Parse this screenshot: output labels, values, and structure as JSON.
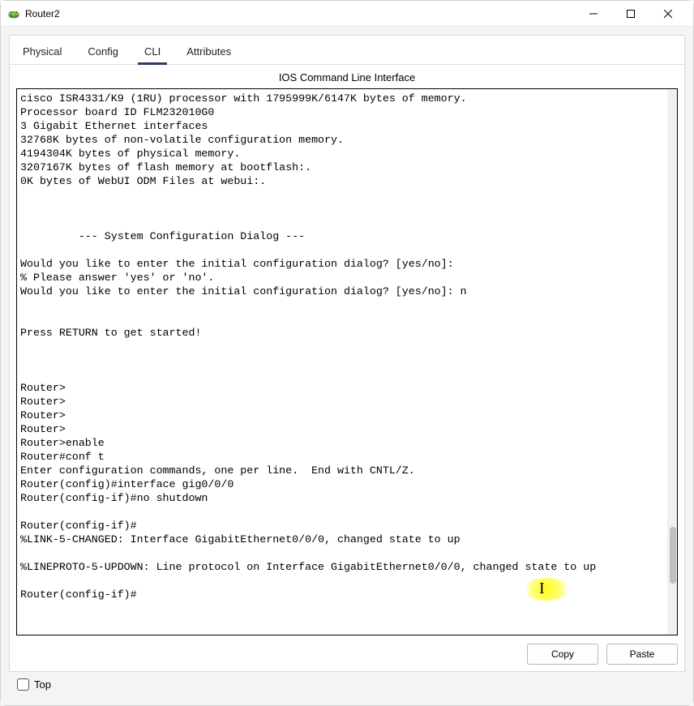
{
  "window": {
    "title": "Router2"
  },
  "tabs": {
    "physical": "Physical",
    "config": "Config",
    "cli": "CLI",
    "attributes": "Attributes"
  },
  "cli": {
    "header": "IOS Command Line Interface",
    "output": "cisco ISR4331/K9 (1RU) processor with 1795999K/6147K bytes of memory.\nProcessor board ID FLM232010G0\n3 Gigabit Ethernet interfaces\n32768K bytes of non-volatile configuration memory.\n4194304K bytes of physical memory.\n3207167K bytes of flash memory at bootflash:.\n0K bytes of WebUI ODM Files at webui:.\n\n\n\n         --- System Configuration Dialog ---\n\nWould you like to enter the initial configuration dialog? [yes/no]: \n% Please answer 'yes' or 'no'.\nWould you like to enter the initial configuration dialog? [yes/no]: n\n\n\nPress RETURN to get started!\n\n\n\nRouter>\nRouter>\nRouter>\nRouter>\nRouter>enable\nRouter#conf t\nEnter configuration commands, one per line.  End with CNTL/Z.\nRouter(config)#interface gig0/0/0\nRouter(config-if)#no shutdown\n\nRouter(config-if)#\n%LINK-5-CHANGED: Interface GigabitEthernet0/0/0, changed state to up\n\n%LINEPROTO-5-UPDOWN: Line protocol on Interface GigabitEthernet0/0/0, changed state to up\n\nRouter(config-if)#"
  },
  "buttons": {
    "copy": "Copy",
    "paste": "Paste"
  },
  "footer": {
    "top_label": "Top"
  }
}
